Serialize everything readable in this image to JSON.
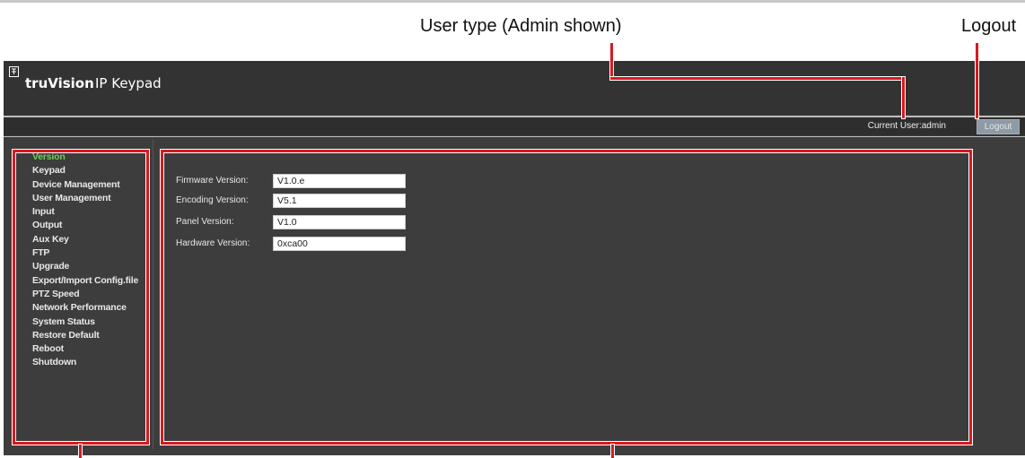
{
  "callouts": {
    "user_type": "User type (Admin shown)",
    "logout": "Logout"
  },
  "header": {
    "brand": "truVision",
    "product": "IP Keypad"
  },
  "userbar": {
    "current_user": "Current User:admin",
    "logout_label": "Logout"
  },
  "sidebar": {
    "items": [
      {
        "label": "Version",
        "active": true
      },
      {
        "label": "Keypad"
      },
      {
        "label": "Device Management"
      },
      {
        "label": "User Management"
      },
      {
        "label": "Input"
      },
      {
        "label": "Output"
      },
      {
        "label": "Aux Key"
      },
      {
        "label": "FTP"
      },
      {
        "label": "Upgrade"
      },
      {
        "label": "Export/Import Config.file"
      },
      {
        "label": "PTZ Speed"
      },
      {
        "label": "Network Performance"
      },
      {
        "label": "System Status"
      },
      {
        "label": "Restore Default"
      },
      {
        "label": "Reboot"
      },
      {
        "label": "Shutdown"
      }
    ]
  },
  "version": {
    "fields": [
      {
        "label": "Firmware Version:",
        "value": "V1.0.e"
      },
      {
        "label": "Encoding Version:",
        "value": "V5.1"
      },
      {
        "label": "Panel Version:",
        "value": "V1.0"
      },
      {
        "label": "Hardware Version:",
        "value": "0xca00"
      }
    ]
  },
  "colors": {
    "annotation": "#d71920",
    "active_nav": "#6fcf5a",
    "panel_bg": "#3d3d3d"
  }
}
